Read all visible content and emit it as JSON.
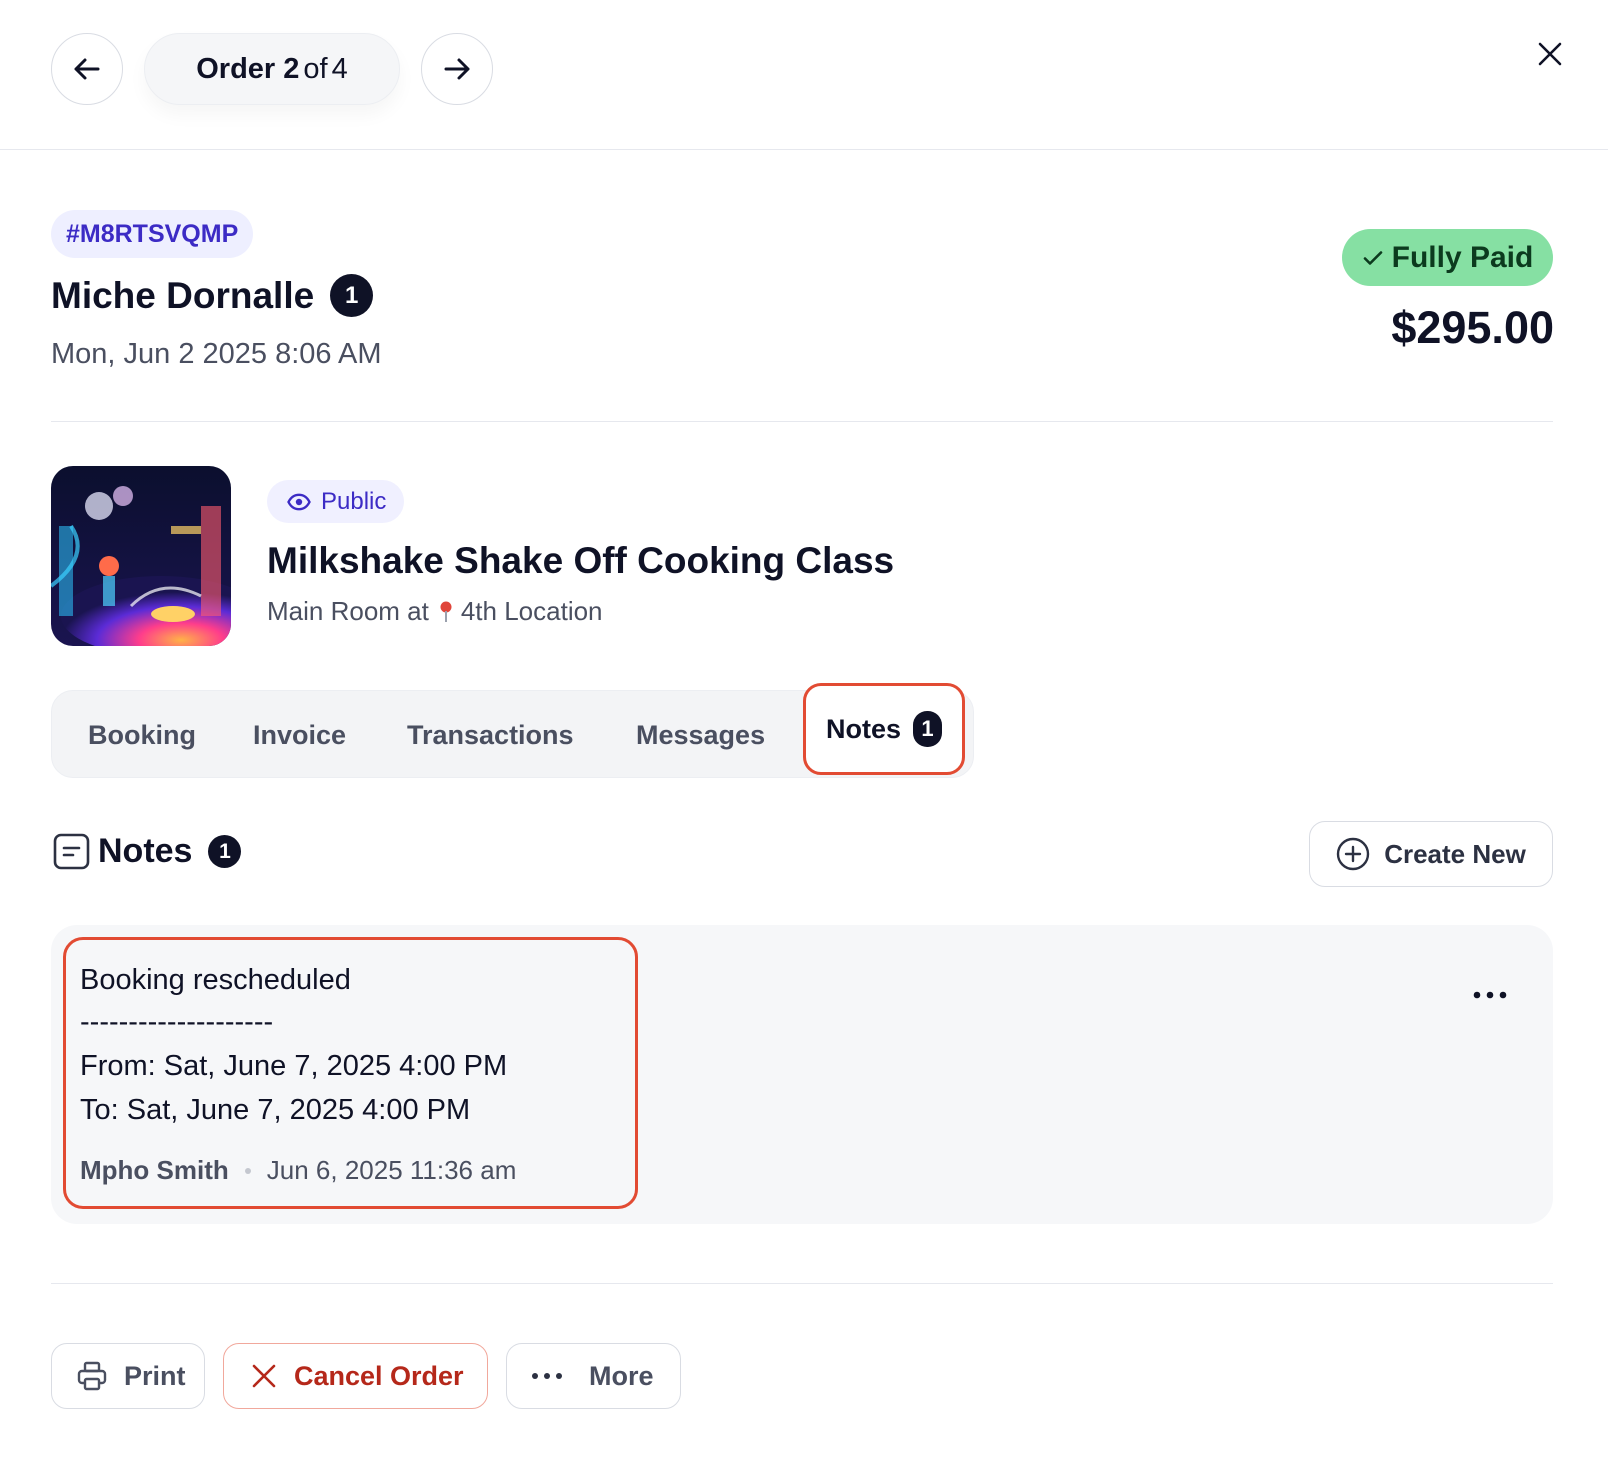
{
  "header": {
    "order_label": "Order",
    "order_current": "2",
    "order_of": "of",
    "order_total": "4"
  },
  "order": {
    "code": "#M8RTSVQMP",
    "customer_name": "Miche Dornalle",
    "customer_badge": "1",
    "date": "Mon, Jun 2 2025 8:06 AM",
    "payment_status": "Fully Paid",
    "total": "$295.00"
  },
  "event": {
    "visibility": "Public",
    "title": "Milkshake Shake Off Cooking Class",
    "room": "Main Room at",
    "location": "4th Location"
  },
  "tabs": [
    {
      "label": "Booking"
    },
    {
      "label": "Invoice"
    },
    {
      "label": "Transactions"
    },
    {
      "label": "Messages"
    },
    {
      "label": "Notes",
      "badge": "1"
    }
  ],
  "notes": {
    "title": "Notes",
    "count": "1",
    "create_label": "Create New",
    "items": [
      {
        "heading": "Booking rescheduled",
        "separator": "--------------------",
        "from": "From: Sat, June 7, 2025 4:00 PM",
        "to": "To: Sat, June 7, 2025 4:00 PM",
        "author": "Mpho Smith",
        "timestamp": "Jun 6, 2025 11:36 am"
      }
    ]
  },
  "footer": {
    "print_label": "Print",
    "cancel_label": "Cancel Order",
    "more_label": "More"
  },
  "colors": {
    "accent": "#3c2bc5",
    "highlight": "#e24b33",
    "paid": "#86e0a3",
    "danger": "#b5281a"
  }
}
